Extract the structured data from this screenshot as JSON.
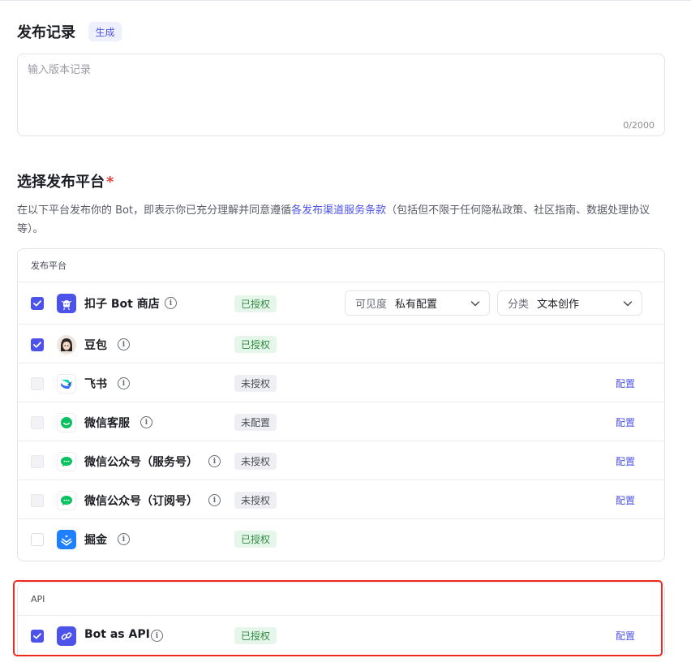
{
  "release": {
    "title": "发布记录",
    "generate_label": "生成",
    "notes_placeholder": "输入版本记录",
    "notes_value": "",
    "counter": "0/2000"
  },
  "platform_section": {
    "title": "选择发布平台",
    "required_mark": "*",
    "desc_before": "在以下平台发布你的 Bot，即表示你已充分理解并同意遵循",
    "desc_link": "各发布渠道服务条款",
    "desc_after": "（包括但不限于任何隐私政策、社区指南、数据处理协议等）。"
  },
  "platforms_card": {
    "header": "发布平台",
    "visibility": {
      "label": "可见度",
      "value": "私有配置"
    },
    "category": {
      "label": "分类",
      "value": "文本创作"
    },
    "rows": [
      {
        "name": "扣子 Bot 商店",
        "status": "已授权",
        "checked": true,
        "icon": "coze-store-icon"
      },
      {
        "name": "豆包",
        "status": "已授权",
        "checked": true,
        "icon": "doubao-avatar-icon"
      },
      {
        "name": "飞书",
        "status": "未授权",
        "checked": false,
        "icon": "feishu-icon",
        "action": "配置"
      },
      {
        "name": "微信客服",
        "status": "未配置",
        "checked": false,
        "icon": "wechat-icon",
        "action": "配置"
      },
      {
        "name": "微信公众号（服务号）",
        "status": "未授权",
        "checked": false,
        "icon": "wechat-icon",
        "action": "配置"
      },
      {
        "name": "微信公众号（订阅号）",
        "status": "未授权",
        "checked": false,
        "icon": "wechat-icon",
        "action": "配置"
      },
      {
        "name": "掘金",
        "status": "已授权",
        "checked": false,
        "icon": "juejin-icon"
      }
    ]
  },
  "api_card": {
    "header": "API",
    "row": {
      "name": "Bot as API",
      "status": "已授权",
      "checked": true,
      "icon": "api-link-icon",
      "action": "配置"
    }
  },
  "colors": {
    "accent": "#4d53e8",
    "authorized_bg": "#e6f6ea",
    "authorized_text": "#2f8a41",
    "highlight_frame": "#ee2a1e"
  }
}
